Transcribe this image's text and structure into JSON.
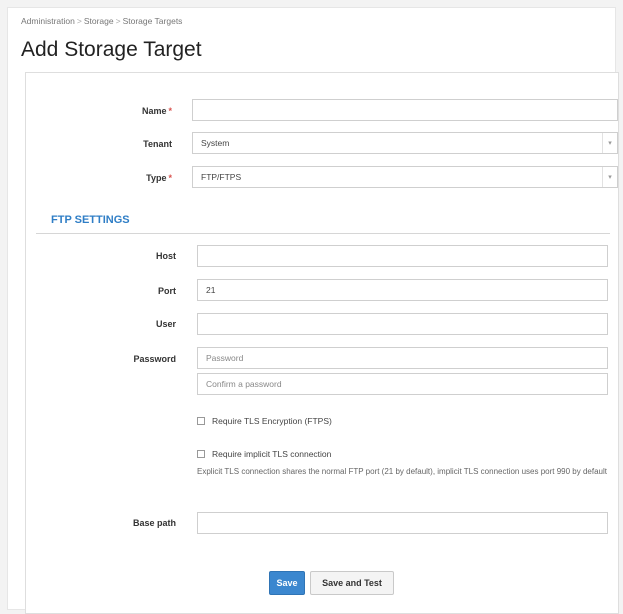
{
  "breadcrumb": {
    "items": [
      "Administration",
      "Storage",
      "Storage Targets"
    ],
    "separator": ">"
  },
  "page_title": "Add Storage Target",
  "form": {
    "name": {
      "label": "Name",
      "required_mark": "*",
      "value": ""
    },
    "tenant": {
      "label": "Tenant",
      "value": "System"
    },
    "type": {
      "label": "Type",
      "required_mark": "*",
      "value": "FTP/FTPS"
    },
    "select_arrow": "▾"
  },
  "ftp_settings": {
    "heading": "FTP SETTINGS",
    "host": {
      "label": "Host",
      "value": ""
    },
    "port": {
      "label": "Port",
      "value": "21"
    },
    "user": {
      "label": "User",
      "value": ""
    },
    "password": {
      "label": "Password",
      "placeholder": "Password"
    },
    "confirm_password": {
      "placeholder": "Confirm a password"
    },
    "require_tls": {
      "label": "Require TLS Encryption (FTPS)",
      "checked": false
    },
    "require_implicit_tls": {
      "label": "Require implicit TLS connection",
      "checked": false
    },
    "hint": "Explicit TLS connection shares the normal FTP port (21 by default), implicit TLS connection uses port 990 by default",
    "base_path": {
      "label": "Base path",
      "value": ""
    }
  },
  "buttons": {
    "save": "Save",
    "save_and_test": "Save and Test"
  },
  "colors": {
    "accent": "#2f7ec6",
    "primary_button": "#3b87cf",
    "required": "#d9534f"
  }
}
